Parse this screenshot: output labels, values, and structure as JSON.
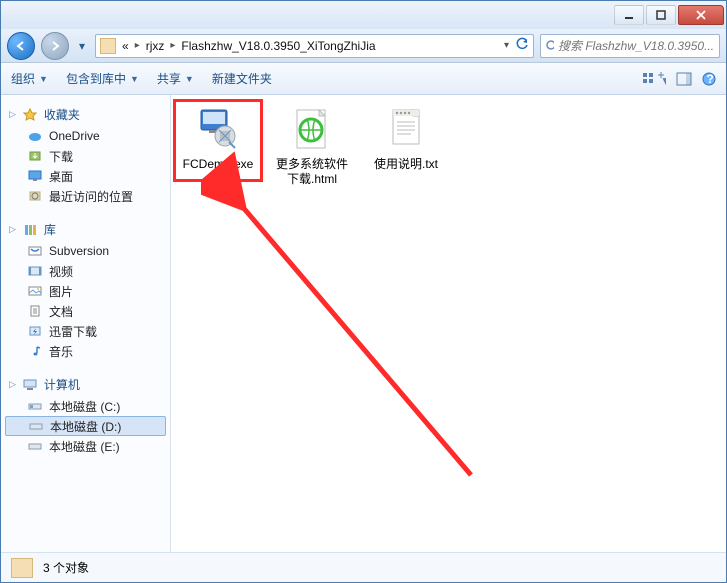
{
  "titlebar": {
    "min": "—",
    "max": "▢",
    "close": "✕"
  },
  "address": {
    "seg1": "«",
    "seg2": "rjxz",
    "seg3": "Flashzhw_V18.0.3950_XiTongZhiJia"
  },
  "search": {
    "placeholder": "搜索 Flashzhw_V18.0.3950..."
  },
  "toolbar": {
    "organize": "组织",
    "include": "包含到库中",
    "share": "共享",
    "newfolder": "新建文件夹"
  },
  "sidebar": {
    "favorites": {
      "label": "收藏夹",
      "items": [
        {
          "icon": "onedrive",
          "label": "OneDrive"
        },
        {
          "icon": "download",
          "label": "下载"
        },
        {
          "icon": "desktop",
          "label": "桌面"
        },
        {
          "icon": "recent",
          "label": "最近访问的位置"
        }
      ]
    },
    "libraries": {
      "label": "库",
      "items": [
        {
          "icon": "svn",
          "label": "Subversion"
        },
        {
          "icon": "video",
          "label": "视频"
        },
        {
          "icon": "picture",
          "label": "图片"
        },
        {
          "icon": "document",
          "label": "文档"
        },
        {
          "icon": "thunder",
          "label": "迅雷下载"
        },
        {
          "icon": "music",
          "label": "音乐"
        }
      ]
    },
    "computer": {
      "label": "计算机",
      "items": [
        {
          "icon": "drive",
          "label": "本地磁盘 (C:)"
        },
        {
          "icon": "drive",
          "label": "本地磁盘 (D:)",
          "sel": true
        },
        {
          "icon": "drive",
          "label": "本地磁盘 (E:)"
        }
      ]
    }
  },
  "files": [
    {
      "name": "FCDemo.exe",
      "icon": "exe",
      "highlight": true
    },
    {
      "name": "更多系统软件下载.html",
      "icon": "html"
    },
    {
      "name": "使用说明.txt",
      "icon": "txt"
    }
  ],
  "status": {
    "text": "3 个对象"
  }
}
